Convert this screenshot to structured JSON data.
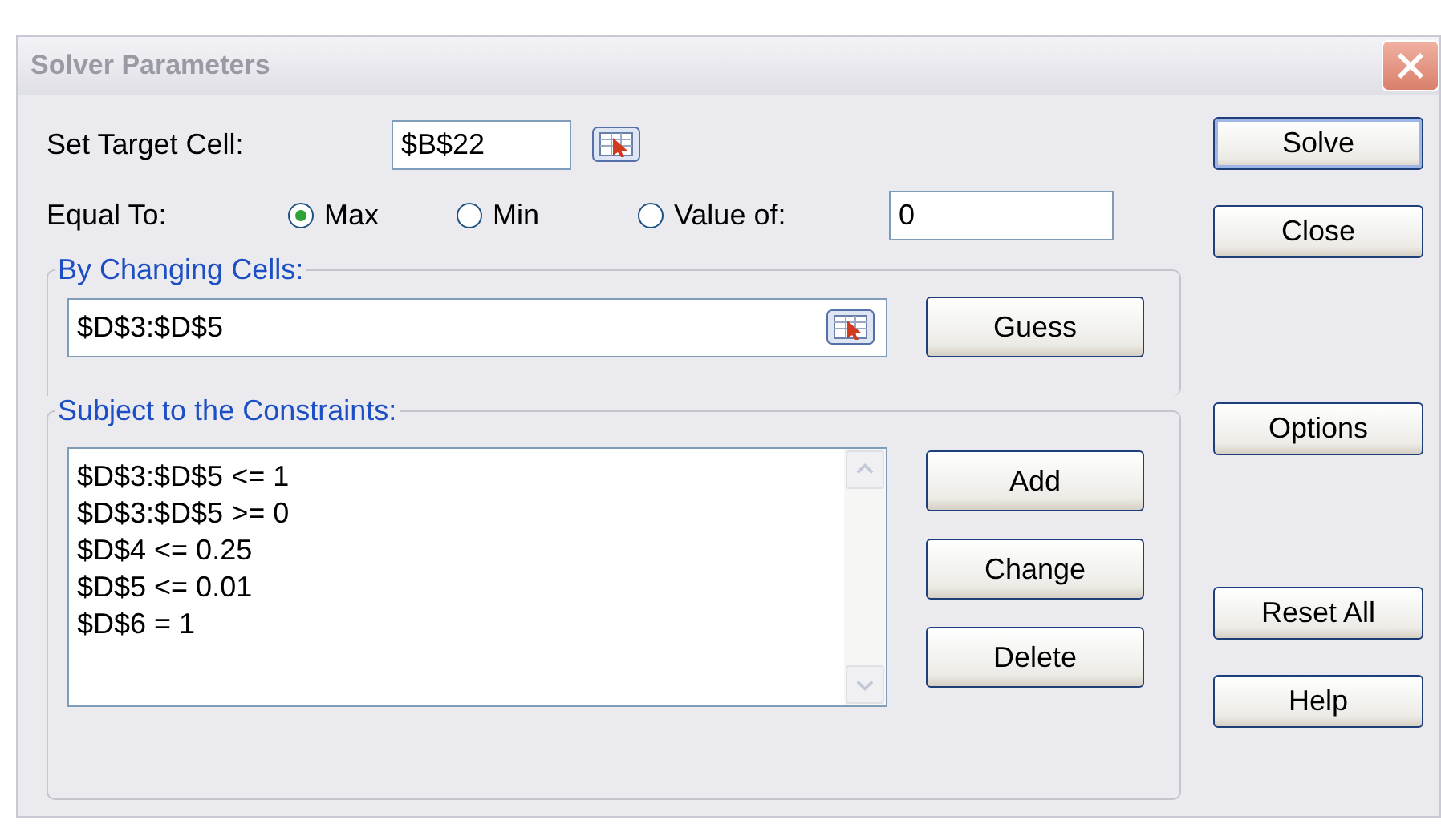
{
  "window": {
    "title": "Solver Parameters"
  },
  "target_cell": {
    "label": "Set Target Cell:",
    "value": "$B$22"
  },
  "equal_to": {
    "label": "Equal To:",
    "options": [
      {
        "label": "Max",
        "selected": true
      },
      {
        "label": "Min",
        "selected": false
      },
      {
        "label": "Value of:",
        "selected": false
      }
    ],
    "value_field": {
      "value": "0"
    }
  },
  "changing_cells": {
    "legend": "By Changing Cells:",
    "value": "$D$3:$D$5",
    "button": {
      "label": "Guess"
    }
  },
  "constraints": {
    "legend": "Subject to the Constraints:",
    "items": [
      "$D$3:$D$5 <= 1",
      "$D$3:$D$5 >= 0",
      "$D$4 <= 0.25",
      "$D$5 <= 0.01",
      "$D$6 = 1"
    ],
    "buttons": [
      {
        "label": "Add"
      },
      {
        "label": "Change"
      },
      {
        "label": "Delete"
      }
    ]
  },
  "side_buttons": [
    {
      "label": "Solve",
      "default": true
    },
    {
      "label": "Close",
      "default": false
    },
    {
      "label": "Options",
      "default": false
    },
    {
      "label": "Reset All",
      "default": false
    },
    {
      "label": "Help",
      "default": false
    }
  ]
}
